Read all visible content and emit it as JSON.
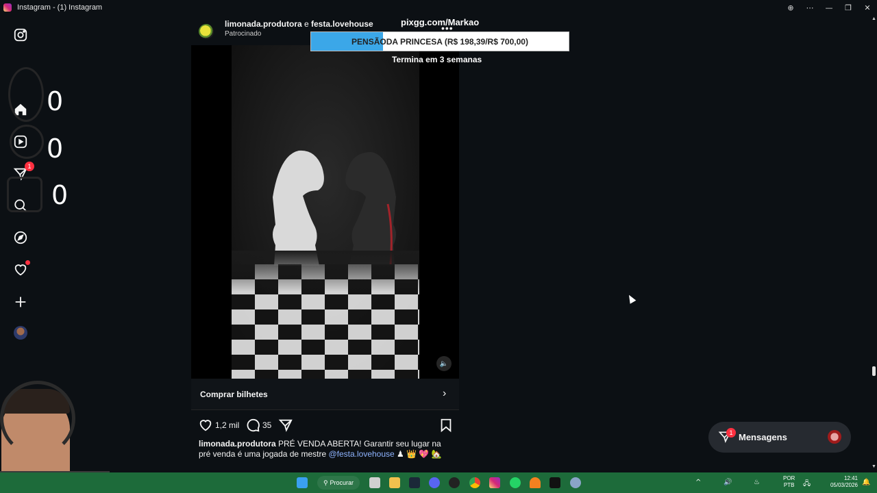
{
  "window": {
    "title": "Instagram - (1) Instagram",
    "controls": {
      "zoom": "⊕",
      "more": "⋯",
      "minimize": "—",
      "restore": "❐",
      "close": "✕"
    }
  },
  "sidebar": {
    "items": [
      {
        "name": "instagram-logo-icon"
      },
      {
        "name": "home-icon"
      },
      {
        "name": "reels-icon"
      },
      {
        "name": "messages-icon",
        "badge": "1"
      },
      {
        "name": "search-icon"
      },
      {
        "name": "explore-icon"
      },
      {
        "name": "notifications-icon"
      },
      {
        "name": "create-icon"
      },
      {
        "name": "profile-avatar"
      }
    ]
  },
  "overlay": {
    "counters": [
      "0",
      "0",
      "0"
    ],
    "url": "pixgg.com/Markao",
    "goal_highlight": "PENSÃO",
    "goal_text": " DA PRINCESA (R$ 198,39/R$ 700,00)",
    "goal_progress": 0.28,
    "subtitle": "Termina em 3 semanas",
    "colors": {
      "progress_fill": "#3ba7e8",
      "progress_bg": "#ffffff"
    }
  },
  "post": {
    "account": "limonada.produtora",
    "conjunction": " e ",
    "collaborator": "festa.lovehouse",
    "sponsored_label": "Patrocinado",
    "more": "•••",
    "mute_icon": "speaker-icon",
    "cta_label": "Comprar bilhetes",
    "cta_chevron": "›",
    "likes": "1,2 mil",
    "comments": "35",
    "caption_user": "limonada.produtora",
    "caption_text": " PRÉ VENDA ABERTA! Garantir seu lugar na pré venda é uma jogada de mestre ",
    "caption_mention": "@festa.lovehouse",
    "caption_emojis": " ♟ 👑 💖 🏡"
  },
  "messages": {
    "label": "Mensagens",
    "badge": "1"
  },
  "taskbar": {
    "search_label": "Procurar",
    "tray_up": "^",
    "lang_line1": "POR",
    "lang_line2": "PTB",
    "time": "12:41",
    "date": "05/03/2026",
    "colors": {
      "background": "#1d6b3a"
    }
  }
}
